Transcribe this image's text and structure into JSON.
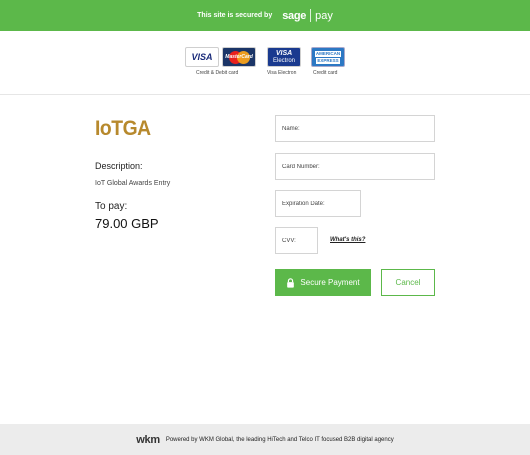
{
  "topbar": {
    "secured_text": "This site is secured by",
    "brand_sage": "sage",
    "brand_pay": "pay"
  },
  "cards": [
    {
      "name": "VISA",
      "caption": "Credit & Debit card"
    },
    {
      "name": "MasterCard",
      "caption": ""
    },
    {
      "name_top": "VISA",
      "name_bottom": "Electron",
      "caption": "Visa Electron"
    },
    {
      "name_top": "AMERICAN",
      "name_bottom": "EXPRESS",
      "caption": "Credit card"
    }
  ],
  "merchant": {
    "logo": "IoTGA",
    "description_label": "Description:",
    "description_value": "IoT Global Awards Entry",
    "to_pay_label": "To pay:",
    "amount": "79.00 GBP"
  },
  "form": {
    "name_placeholder": "Name:",
    "card_number_placeholder": "Card Number:",
    "expiration_placeholder": "Expiration Date:",
    "cvv_placeholder": "CVV:",
    "whats_this": "What's this?",
    "secure_payment_label": "Secure Payment",
    "cancel_label": "Cancel"
  },
  "footer": {
    "logo": "wkm",
    "text": "Powered by WKM Global, the leading HiTech and Telco IT focused B2B digital agency"
  },
  "colors": {
    "brand_green": "#5cb84a",
    "logo_gold": "#b7892d",
    "footer_bg": "#ececec"
  }
}
